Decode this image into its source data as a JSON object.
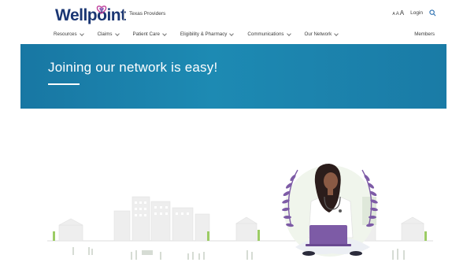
{
  "header": {
    "logo_text": "Wellpoint",
    "region": "Texas Providers",
    "fontsize_small": "A",
    "fontsize_medium": "A",
    "fontsize_large": "A",
    "login_label": "Login"
  },
  "nav": {
    "items": [
      {
        "label": "Resources"
      },
      {
        "label": "Claims"
      },
      {
        "label": "Patient Care"
      },
      {
        "label": "Eligibility & Pharmacy"
      },
      {
        "label": "Communications"
      },
      {
        "label": "Our Network"
      }
    ],
    "members_label": "Members"
  },
  "hero": {
    "title": "Joining our network is easy!"
  },
  "colors": {
    "brand_navy": "#1a3673",
    "hero_blue": "#1d8ab3",
    "accent_purple": "#7d5ba6",
    "leaf_green": "#8bc34a"
  },
  "icons": {
    "logo_mark": "heart-flower-icon",
    "search": "search-icon",
    "chevron": "chevron-down-icon"
  }
}
